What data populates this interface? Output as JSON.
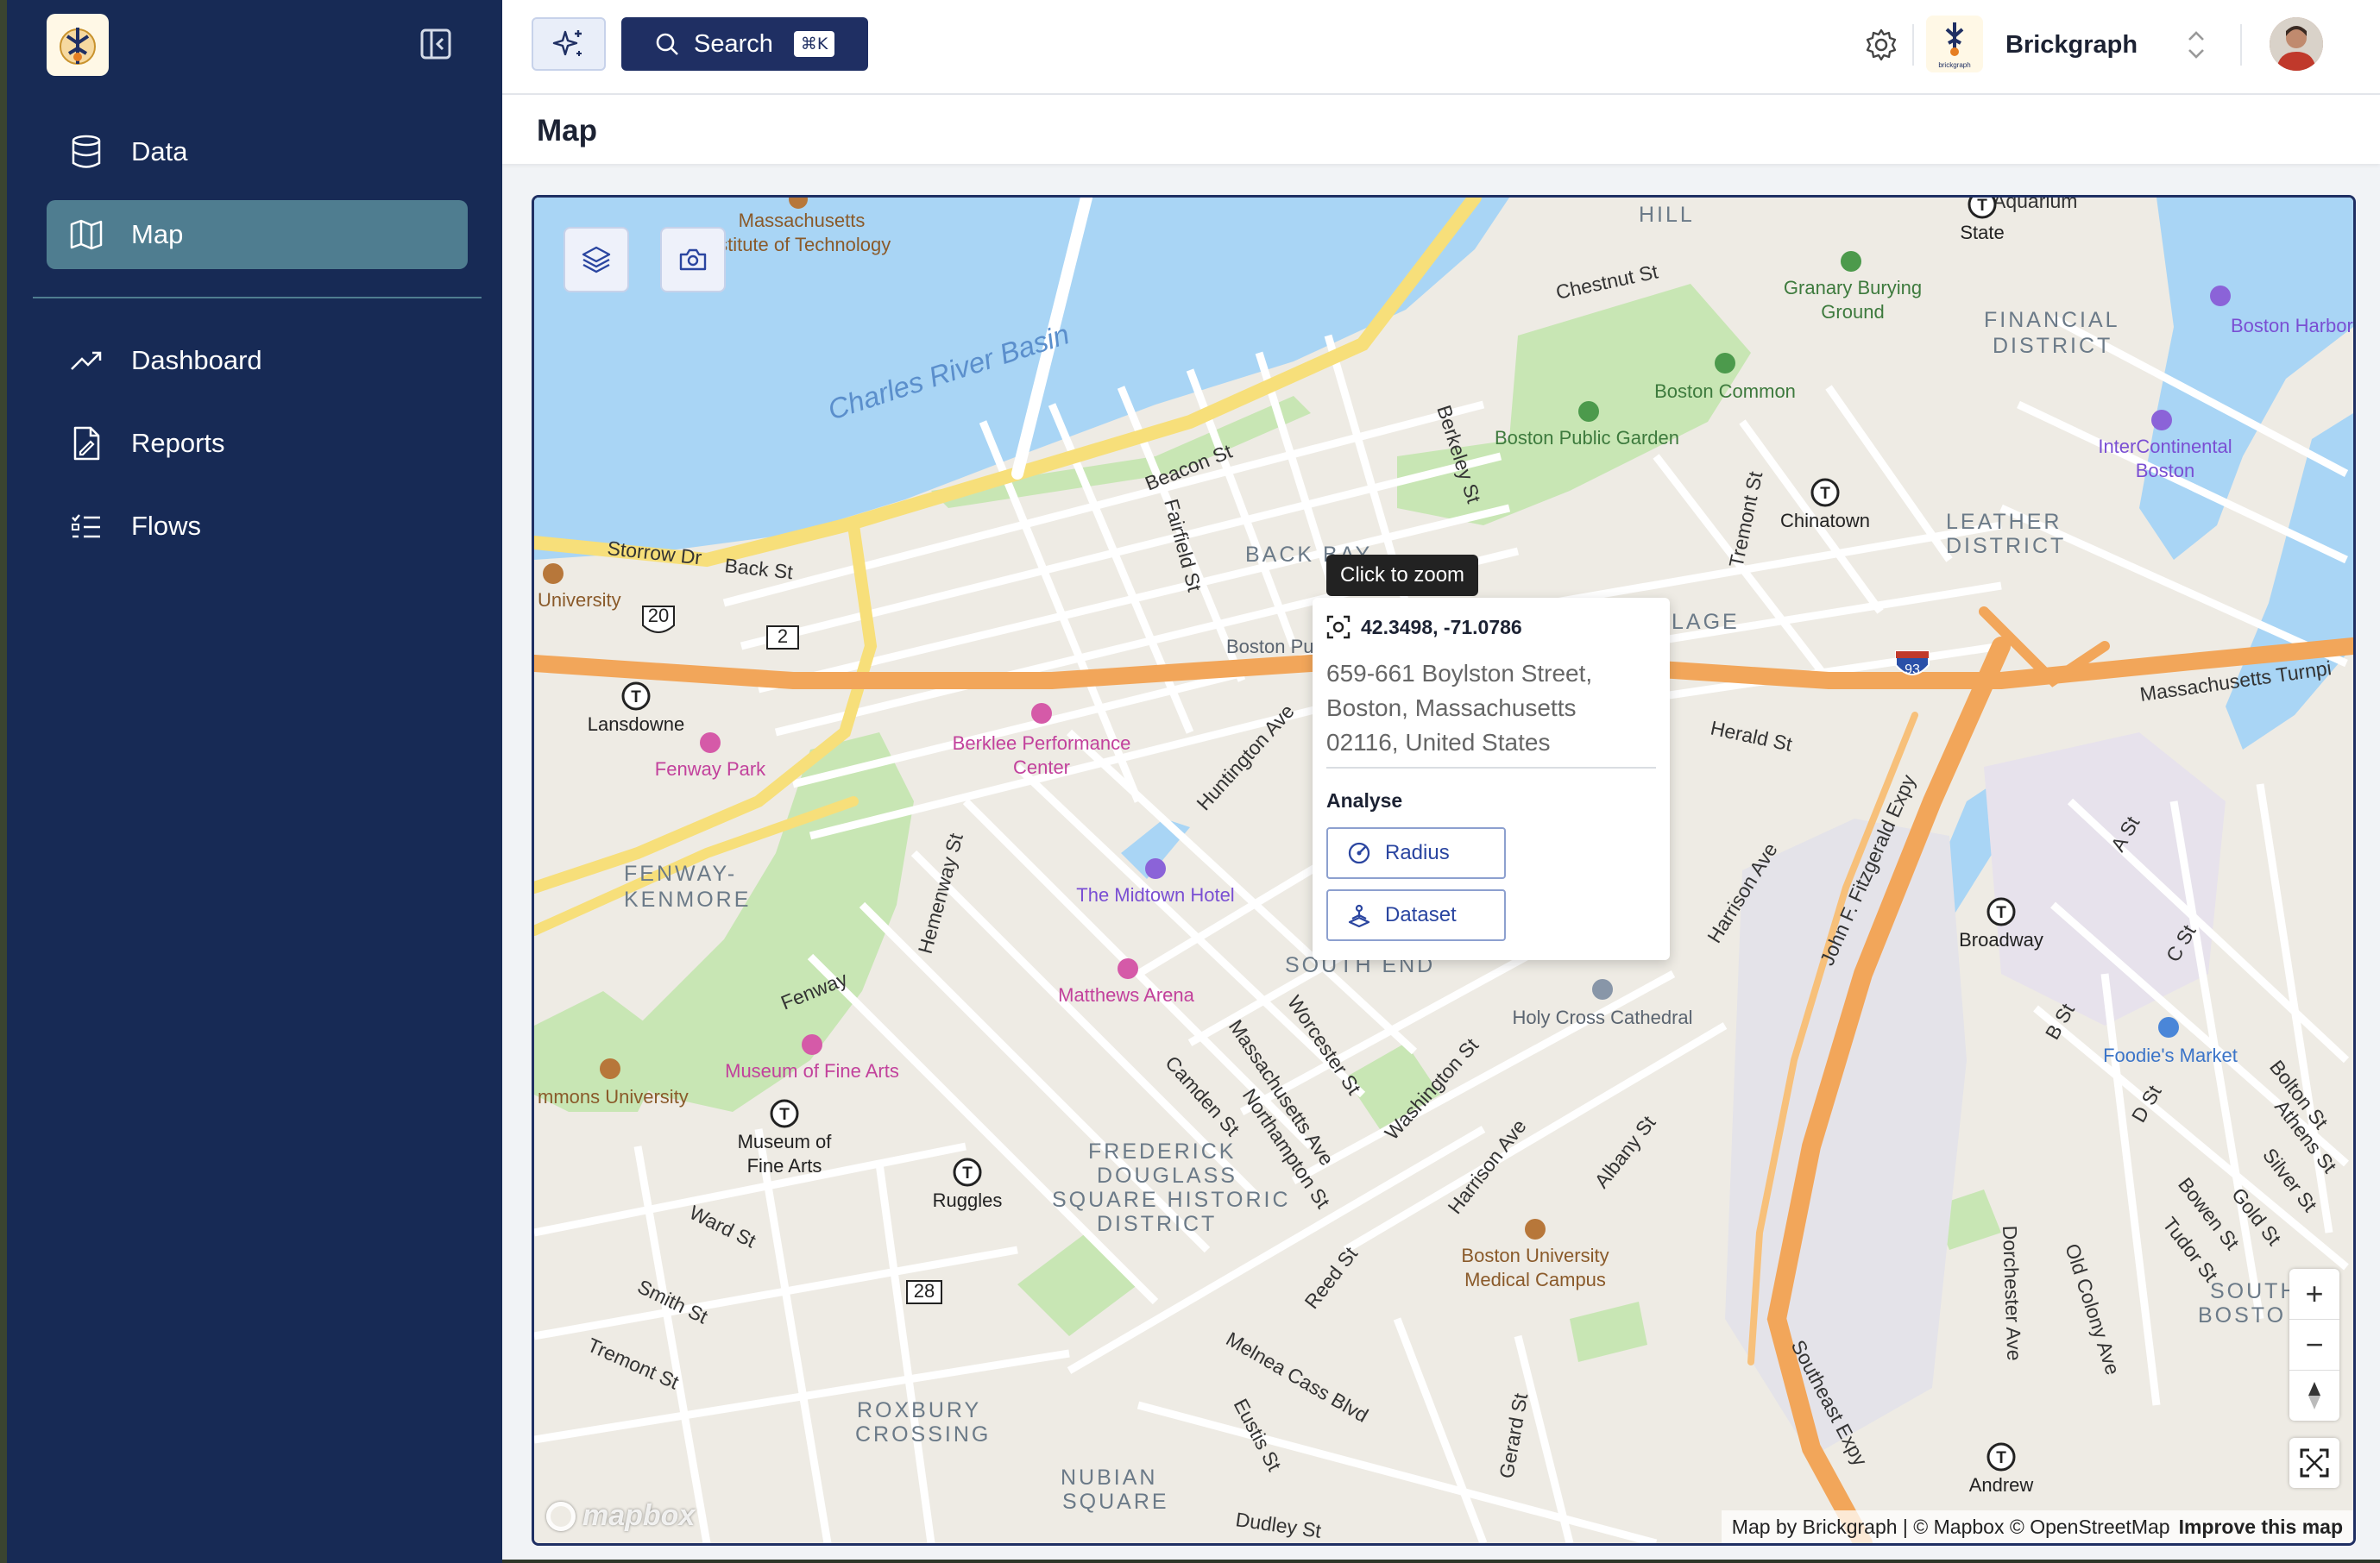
{
  "sidebar": {
    "collapse_icon": "panel-left-collapse-icon",
    "items": [
      {
        "label": "Data",
        "icon": "database-icon",
        "active": false
      },
      {
        "label": "Map",
        "icon": "map-icon",
        "active": true
      },
      {
        "label": "Dashboard",
        "icon": "trending-up-icon",
        "active": false
      },
      {
        "label": "Reports",
        "icon": "report-file-icon",
        "active": false
      },
      {
        "label": "Flows",
        "icon": "list-checks-icon",
        "active": false
      }
    ]
  },
  "topbar": {
    "search_label": "Search",
    "search_shortcut": "⌘K",
    "org_name": "Brickgraph",
    "org_logo_text": "brickgraph"
  },
  "page": {
    "title": "Map"
  },
  "map": {
    "tooltip": "Click to zoom",
    "popup": {
      "coords": "42.3498, -71.0786",
      "address_lines": [
        "659-661 Boylston Street,",
        "Boston, Massachusetts",
        "02116, United States"
      ],
      "analyse_label": "Analyse",
      "radius_label": "Radius",
      "dataset_label": "Dataset"
    },
    "zoom_in": "+",
    "zoom_out": "−",
    "attribution": "Map by Brickgraph | © Mapbox © OpenStreetMap",
    "improve": "Improve this map",
    "mapbox_logo": "mapbox",
    "labels": {
      "water": "Charles River Basin",
      "areas": [
        "HILL",
        "FINANCIAL",
        "DISTRICT",
        "BACK BAY",
        "LEATHER",
        "DISTRICT",
        "FENWAY-",
        "KENMORE",
        "SOUTH END",
        "FREDERICK",
        "DOUGLASS",
        "SQUARE HISTORIC",
        "DISTRICT",
        "ROXBURY",
        "CROSSING",
        "NUBIAN",
        "SQUARE",
        "SOUTH",
        "BOSTO",
        "LAGE"
      ],
      "streets": [
        "Chestnut St",
        "Beacon St",
        "Berkeley St",
        "Fairfield St",
        "Storrow Dr",
        "Back St",
        "Tremont St",
        "Huntington Ave",
        "Herald St",
        "Hemenway St",
        "Fenway",
        "Harrison Ave",
        "John F. Fitzgerald Expy",
        "Massachusetts Turnpi",
        "Worcester St",
        "Massachusetts Ave",
        "Northampton St",
        "Camden St",
        "Washington St",
        "Harrison Ave",
        "Albany St",
        "Ward St",
        "Smith St",
        "Tremont St",
        "Reed St",
        "Melnea Cass Blvd",
        "Eustis St",
        "Gerard St",
        "Dudley St",
        "Southeast Expy",
        "Dorchester Ave",
        "Old Colony Ave",
        "A St",
        "C St",
        "B St",
        "D St",
        "Bolton St",
        "Athens St",
        "Silver St",
        "Gold St",
        "Bowen St",
        "Tudor St",
        "Aquarium"
      ],
      "pois": [
        {
          "name": "Massachusetts",
          "kind": "brown"
        },
        {
          "name": "Institute of Technology",
          "kind": "brown"
        },
        {
          "name": "Granary Burying",
          "kind": "green"
        },
        {
          "name": "Ground",
          "kind": "green"
        },
        {
          "name": "Boston Common",
          "kind": "green"
        },
        {
          "name": "Boston Public Garden",
          "kind": "green"
        },
        {
          "name": "Boston Harbor Hotel",
          "kind": "purple"
        },
        {
          "name": "InterContinental",
          "kind": "purple"
        },
        {
          "name": "Boston",
          "kind": "purple"
        },
        {
          "name": "University",
          "kind": "brown"
        },
        {
          "name": "Boston Pu",
          "kind": "gray"
        },
        {
          "name": "Fenway Park",
          "kind": "pink"
        },
        {
          "name": "Berklee Performance",
          "kind": "pink"
        },
        {
          "name": "Center",
          "kind": "pink"
        },
        {
          "name": "The Midtown Hotel",
          "kind": "purple"
        },
        {
          "name": "Matthews Arena",
          "kind": "pink"
        },
        {
          "name": "Holy Cross Cathedral",
          "kind": "gray"
        },
        {
          "name": "Foodie's Market",
          "kind": "blue"
        },
        {
          "name": "Museum of Fine Arts",
          "kind": "pink"
        },
        {
          "name": "mmons University",
          "kind": "brown"
        },
        {
          "name": "Boston University",
          "kind": "brown"
        },
        {
          "name": "Medical Campus",
          "kind": "brown"
        }
      ],
      "transit": [
        "State",
        "Chinatown",
        "Lansdowne",
        "Broadway",
        "Museum of",
        "Fine Arts",
        "Ruggles",
        "Andrew"
      ],
      "shields": [
        "20",
        "2",
        "93",
        "28"
      ]
    }
  },
  "colors": {
    "sidebar_bg": "#172a55",
    "active_item": "#4f7d90",
    "search_btn": "#1f2f63",
    "water": "#a9d5f5",
    "park": "#c8e6b4",
    "highway": "#f2a65a",
    "major_road": "#f7df7a"
  }
}
